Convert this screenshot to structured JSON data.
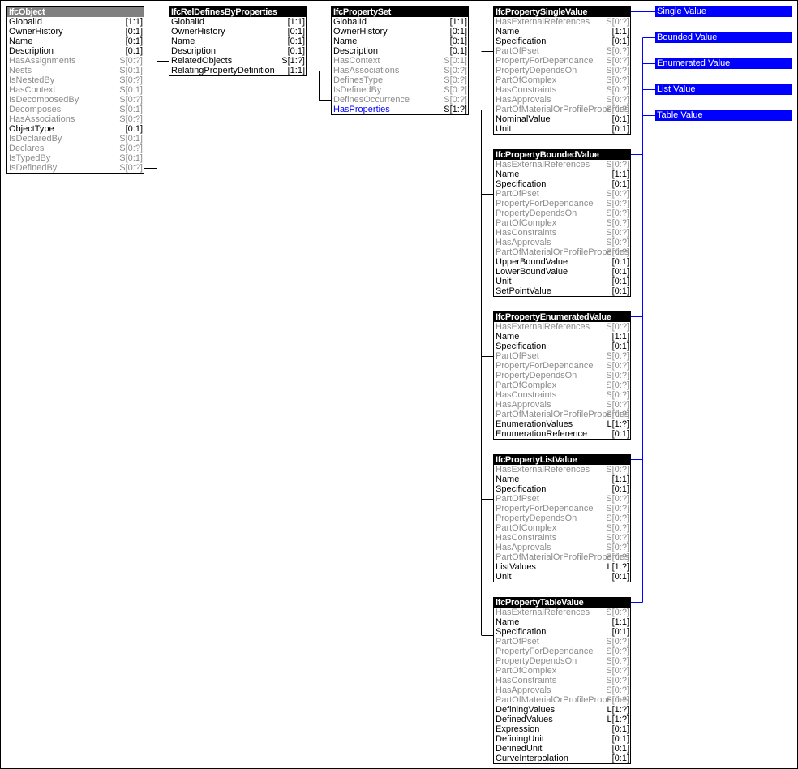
{
  "entities": [
    {
      "id": "ifc-object",
      "name": "IfcObject",
      "style": "grey",
      "attributes": [
        {
          "name": "GlobalId",
          "card": "[1:1]",
          "kind": "dir"
        },
        {
          "name": "OwnerHistory",
          "card": "[0:1]",
          "kind": "dir"
        },
        {
          "name": "Name",
          "card": "[0:1]",
          "kind": "dir"
        },
        {
          "name": "Description",
          "card": "[0:1]",
          "kind": "dir"
        },
        {
          "name": "HasAssignments",
          "card": "S[0:?]",
          "kind": "inv"
        },
        {
          "name": "Nests",
          "card": "S[0:1]",
          "kind": "inv"
        },
        {
          "name": "IsNestedBy",
          "card": "S[0:?]",
          "kind": "inv"
        },
        {
          "name": "HasContext",
          "card": "S[0:1]",
          "kind": "inv"
        },
        {
          "name": "IsDecomposedBy",
          "card": "S[0:?]",
          "kind": "inv"
        },
        {
          "name": "Decomposes",
          "card": "S[0:1]",
          "kind": "inv"
        },
        {
          "name": "HasAssociations",
          "card": "S[0:?]",
          "kind": "inv"
        },
        {
          "name": "ObjectType",
          "card": "[0:1]",
          "kind": "dir"
        },
        {
          "name": "IsDeclaredBy",
          "card": "S[0:1]",
          "kind": "inv"
        },
        {
          "name": "Declares",
          "card": "S[0:?]",
          "kind": "inv"
        },
        {
          "name": "IsTypedBy",
          "card": "S[0:1]",
          "kind": "inv"
        },
        {
          "name": "IsDefinedBy",
          "card": "S[0:?]",
          "kind": "inv"
        }
      ]
    },
    {
      "id": "ifc-rel-defines-by-properties",
      "name": "IfcRelDefinesByProperties",
      "style": "black",
      "attributes": [
        {
          "name": "GlobalId",
          "card": "[1:1]",
          "kind": "dir"
        },
        {
          "name": "OwnerHistory",
          "card": "[0:1]",
          "kind": "dir"
        },
        {
          "name": "Name",
          "card": "[0:1]",
          "kind": "dir"
        },
        {
          "name": "Description",
          "card": "[0:1]",
          "kind": "dir"
        },
        {
          "name": "RelatedObjects",
          "card": "S[1:?]",
          "kind": "dir"
        },
        {
          "name": "RelatingPropertyDefinition",
          "card": "[1:1]",
          "kind": "dir"
        }
      ]
    },
    {
      "id": "ifc-property-set",
      "name": "IfcPropertySet",
      "style": "black",
      "attributes": [
        {
          "name": "GlobalId",
          "card": "[1:1]",
          "kind": "dir"
        },
        {
          "name": "OwnerHistory",
          "card": "[0:1]",
          "kind": "dir"
        },
        {
          "name": "Name",
          "card": "[0:1]",
          "kind": "dir"
        },
        {
          "name": "Description",
          "card": "[0:1]",
          "kind": "dir"
        },
        {
          "name": "HasContext",
          "card": "S[0:1]",
          "kind": "inv"
        },
        {
          "name": "HasAssociations",
          "card": "S[0:?]",
          "kind": "inv"
        },
        {
          "name": "DefinesType",
          "card": "S[0:?]",
          "kind": "inv"
        },
        {
          "name": "IsDefinedBy",
          "card": "S[0:?]",
          "kind": "inv"
        },
        {
          "name": "DefinesOccurrence",
          "card": "S[0:?]",
          "kind": "inv"
        },
        {
          "name": "HasProperties",
          "card": "S[1:?]",
          "kind": "sel"
        }
      ]
    },
    {
      "id": "ifc-property-single-value",
      "name": "IfcPropertySingleValue",
      "style": "black",
      "attributes": [
        {
          "name": "HasExternalReferences",
          "card": "S[0:?]",
          "kind": "inv"
        },
        {
          "name": "Name",
          "card": "[1:1]",
          "kind": "dir"
        },
        {
          "name": "Specification",
          "card": "[0:1]",
          "kind": "dir"
        },
        {
          "name": "PartOfPset",
          "card": "S[0:?]",
          "kind": "inv"
        },
        {
          "name": "PropertyForDependance",
          "card": "S[0:?]",
          "kind": "inv"
        },
        {
          "name": "PropertyDependsOn",
          "card": "S[0:?]",
          "kind": "inv"
        },
        {
          "name": "PartOfComplex",
          "card": "S[0:?]",
          "kind": "inv"
        },
        {
          "name": "HasConstraints",
          "card": "S[0:?]",
          "kind": "inv"
        },
        {
          "name": "HasApprovals",
          "card": "S[0:?]",
          "kind": "inv"
        },
        {
          "name": "PartOfMaterialOrProfileProperties",
          "card": "S[0:?]",
          "kind": "inv"
        },
        {
          "name": "NominalValue",
          "card": "[0:1]",
          "kind": "dir"
        },
        {
          "name": "Unit",
          "card": "[0:1]",
          "kind": "dir"
        }
      ]
    },
    {
      "id": "ifc-property-bounded-value",
      "name": "IfcPropertyBoundedValue",
      "style": "black",
      "attributes": [
        {
          "name": "HasExternalReferences",
          "card": "S[0:?]",
          "kind": "inv"
        },
        {
          "name": "Name",
          "card": "[1:1]",
          "kind": "dir"
        },
        {
          "name": "Specification",
          "card": "[0:1]",
          "kind": "dir"
        },
        {
          "name": "PartOfPset",
          "card": "S[0:?]",
          "kind": "inv"
        },
        {
          "name": "PropertyForDependance",
          "card": "S[0:?]",
          "kind": "inv"
        },
        {
          "name": "PropertyDependsOn",
          "card": "S[0:?]",
          "kind": "inv"
        },
        {
          "name": "PartOfComplex",
          "card": "S[0:?]",
          "kind": "inv"
        },
        {
          "name": "HasConstraints",
          "card": "S[0:?]",
          "kind": "inv"
        },
        {
          "name": "HasApprovals",
          "card": "S[0:?]",
          "kind": "inv"
        },
        {
          "name": "PartOfMaterialOrProfileProperties",
          "card": "S[0:?]",
          "kind": "inv"
        },
        {
          "name": "UpperBoundValue",
          "card": "[0:1]",
          "kind": "dir"
        },
        {
          "name": "LowerBoundValue",
          "card": "[0:1]",
          "kind": "dir"
        },
        {
          "name": "Unit",
          "card": "[0:1]",
          "kind": "dir"
        },
        {
          "name": "SetPointValue",
          "card": "[0:1]",
          "kind": "dir"
        }
      ]
    },
    {
      "id": "ifc-property-enumerated-value",
      "name": "IfcPropertyEnumeratedValue",
      "style": "black",
      "attributes": [
        {
          "name": "HasExternalReferences",
          "card": "S[0:?]",
          "kind": "inv"
        },
        {
          "name": "Name",
          "card": "[1:1]",
          "kind": "dir"
        },
        {
          "name": "Specification",
          "card": "[0:1]",
          "kind": "dir"
        },
        {
          "name": "PartOfPset",
          "card": "S[0:?]",
          "kind": "inv"
        },
        {
          "name": "PropertyForDependance",
          "card": "S[0:?]",
          "kind": "inv"
        },
        {
          "name": "PropertyDependsOn",
          "card": "S[0:?]",
          "kind": "inv"
        },
        {
          "name": "PartOfComplex",
          "card": "S[0:?]",
          "kind": "inv"
        },
        {
          "name": "HasConstraints",
          "card": "S[0:?]",
          "kind": "inv"
        },
        {
          "name": "HasApprovals",
          "card": "S[0:?]",
          "kind": "inv"
        },
        {
          "name": "PartOfMaterialOrProfileProperties",
          "card": "S[0:?]",
          "kind": "inv"
        },
        {
          "name": "EnumerationValues",
          "card": "L[1:?]",
          "kind": "dir"
        },
        {
          "name": "EnumerationReference",
          "card": "[0:1]",
          "kind": "dir"
        }
      ]
    },
    {
      "id": "ifc-property-list-value",
      "name": "IfcPropertyListValue",
      "style": "black",
      "attributes": [
        {
          "name": "HasExternalReferences",
          "card": "S[0:?]",
          "kind": "inv"
        },
        {
          "name": "Name",
          "card": "[1:1]",
          "kind": "dir"
        },
        {
          "name": "Specification",
          "card": "[0:1]",
          "kind": "dir"
        },
        {
          "name": "PartOfPset",
          "card": "S[0:?]",
          "kind": "inv"
        },
        {
          "name": "PropertyForDependance",
          "card": "S[0:?]",
          "kind": "inv"
        },
        {
          "name": "PropertyDependsOn",
          "card": "S[0:?]",
          "kind": "inv"
        },
        {
          "name": "PartOfComplex",
          "card": "S[0:?]",
          "kind": "inv"
        },
        {
          "name": "HasConstraints",
          "card": "S[0:?]",
          "kind": "inv"
        },
        {
          "name": "HasApprovals",
          "card": "S[0:?]",
          "kind": "inv"
        },
        {
          "name": "PartOfMaterialOrProfileProperties",
          "card": "S[0:?]",
          "kind": "inv"
        },
        {
          "name": "ListValues",
          "card": "L[1:?]",
          "kind": "dir"
        },
        {
          "name": "Unit",
          "card": "[0:1]",
          "kind": "dir"
        }
      ]
    },
    {
      "id": "ifc-property-table-value",
      "name": "IfcPropertyTableValue",
      "style": "black",
      "attributes": [
        {
          "name": "HasExternalReferences",
          "card": "S[0:?]",
          "kind": "inv"
        },
        {
          "name": "Name",
          "card": "[1:1]",
          "kind": "dir"
        },
        {
          "name": "Specification",
          "card": "[0:1]",
          "kind": "dir"
        },
        {
          "name": "PartOfPset",
          "card": "S[0:?]",
          "kind": "inv"
        },
        {
          "name": "PropertyForDependance",
          "card": "S[0:?]",
          "kind": "inv"
        },
        {
          "name": "PropertyDependsOn",
          "card": "S[0:?]",
          "kind": "inv"
        },
        {
          "name": "PartOfComplex",
          "card": "S[0:?]",
          "kind": "inv"
        },
        {
          "name": "HasConstraints",
          "card": "S[0:?]",
          "kind": "inv"
        },
        {
          "name": "HasApprovals",
          "card": "S[0:?]",
          "kind": "inv"
        },
        {
          "name": "PartOfMaterialOrProfileProperties",
          "card": "S[0:?]",
          "kind": "inv"
        },
        {
          "name": "DefiningValues",
          "card": "L[1:?]",
          "kind": "dir"
        },
        {
          "name": "DefinedValues",
          "card": "L[1:?]",
          "kind": "dir"
        },
        {
          "name": "Expression",
          "card": "[0:1]",
          "kind": "dir"
        },
        {
          "name": "DefiningUnit",
          "card": "[0:1]",
          "kind": "dir"
        },
        {
          "name": "DefinedUnit",
          "card": "[0:1]",
          "kind": "dir"
        },
        {
          "name": "CurveInterpolation",
          "card": "[0:1]",
          "kind": "dir"
        }
      ]
    }
  ],
  "labels": [
    {
      "text": "Single Value"
    },
    {
      "text": "Bounded Value"
    },
    {
      "text": "Enumerated Value"
    },
    {
      "text": "List Value"
    },
    {
      "text": "Table Value"
    }
  ],
  "colors": {
    "direct_attribute": "#000000",
    "inverse_attribute": "#8c8c8c",
    "selected_attribute": "#0000ff",
    "label_background": "#0000ff",
    "connector_black": "#000000",
    "connector_blue": "#0000ff",
    "header_black": "#000000",
    "header_grey": "#808080"
  }
}
